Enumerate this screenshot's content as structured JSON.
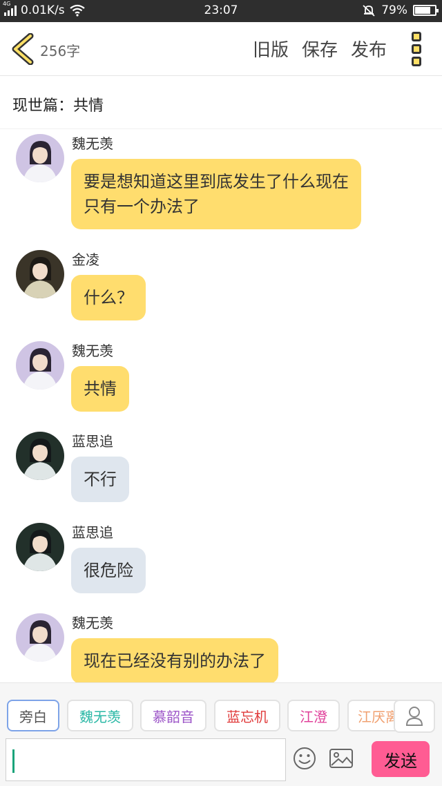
{
  "status_bar": {
    "network": "4G",
    "speed": "0.01K/s",
    "time": "23:07",
    "battery": "79%",
    "battery_level": 0.79
  },
  "header": {
    "word_count": "256字",
    "old_version_label": "旧版",
    "save_label": "保存",
    "publish_label": "发布"
  },
  "title": "现世篇：共情",
  "messages": [
    {
      "name": "魏无羡",
      "text": "要是想知道这里到底发生了什么现在\n只有一个办法了",
      "bubble": "yellow",
      "avatar": "wei-wuxian-avatar"
    },
    {
      "name": "金凌",
      "text": "什么？",
      "bubble": "yellow",
      "avatar": "jin-ling-avatar"
    },
    {
      "name": "魏无羡",
      "text": "共情",
      "bubble": "yellow",
      "avatar": "wei-wuxian-avatar"
    },
    {
      "name": "蓝思追",
      "text": "不行",
      "bubble": "gray",
      "avatar": "lan-sizhui-avatar"
    },
    {
      "name": "蓝思追",
      "text": "很危险",
      "bubble": "gray",
      "avatar": "lan-sizhui-avatar"
    },
    {
      "name": "魏无羡",
      "text": "现在已经没有别的办法了",
      "bubble": "yellow",
      "avatar": "wei-wuxian-avatar"
    }
  ],
  "characters": [
    {
      "label": "旁白",
      "color": "#555555",
      "selected": true
    },
    {
      "label": "魏无羡",
      "color": "#2bb8a6",
      "selected": false
    },
    {
      "label": "慕韶音",
      "color": "#9c55c8",
      "selected": false
    },
    {
      "label": "蓝忘机",
      "color": "#e03a3a",
      "selected": false
    },
    {
      "label": "江澄",
      "color": "#e0409a",
      "selected": false
    },
    {
      "label": "江厌离",
      "color": "#f0a070",
      "selected": false
    }
  ],
  "input": {
    "value": "",
    "placeholder": ""
  },
  "send_label": "发送",
  "colors": {
    "accent_yellow": "#ffdd6e",
    "gray_bubble": "#dfe6ee",
    "send_pink": "#ff5c93"
  }
}
